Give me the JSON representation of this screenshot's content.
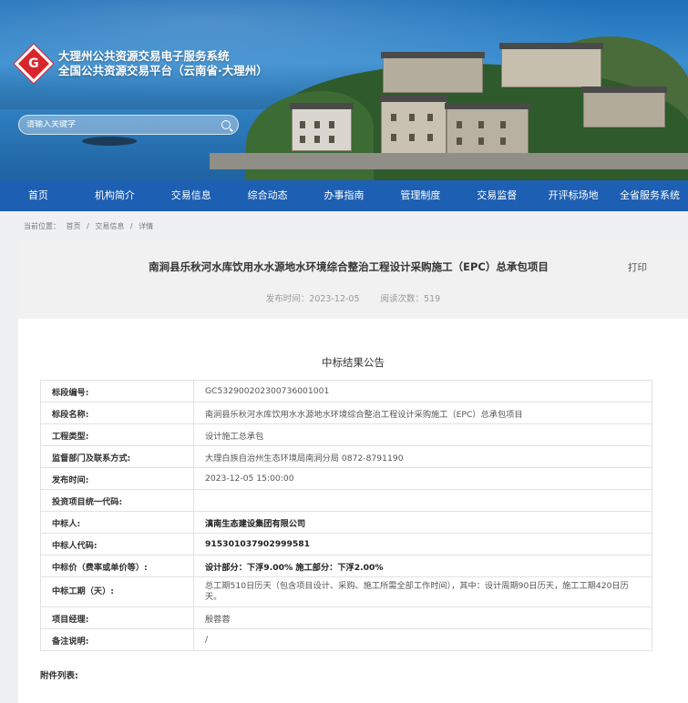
{
  "site": {
    "title_line1": "大理州公共资源交易电子服务系统",
    "title_line2": "全国公共资源交易平台（云南省·大理州）",
    "logo_glyph": "G"
  },
  "search": {
    "placeholder": "请输入关键字"
  },
  "nav": {
    "items": [
      "首页",
      "机构简介",
      "交易信息",
      "综合动态",
      "办事指南",
      "管理制度",
      "交易监督",
      "开评标场地",
      "全省服务系统"
    ]
  },
  "breadcrumb": {
    "prefix": "当前位置：",
    "items": [
      "首页",
      "交易信息",
      "详情"
    ],
    "separator": "/"
  },
  "article": {
    "title": "南涧县乐秋河水库饮用水水源地水环境综合整治工程设计采购施工（EPC）总承包项目",
    "print_label": "打印",
    "publish_label": "发布时间：2023-12-05",
    "views_label": "阅读次数：519",
    "notice_title": "中标结果公告"
  },
  "table": {
    "rows": [
      {
        "key": "标段编号:",
        "value": "GC532900202300736001001"
      },
      {
        "key": "标段名称:",
        "value": "南涧县乐秋河水库饮用水水源地水环境综合整治工程设计采购施工（EPC）总承包项目"
      },
      {
        "key": "工程类型:",
        "value": "设计施工总承包"
      },
      {
        "key": "监督部门及联系方式:",
        "value": "大理白族自治州生态环境局南涧分局 0872-8791190"
      },
      {
        "key": "发布时间:",
        "value": "2023-12-05 15:00:00"
      },
      {
        "key": "投资项目统一代码:",
        "value": ""
      },
      {
        "key": "中标人:",
        "value": "滇南生态建设集团有限公司"
      },
      {
        "key": "中标人代码:",
        "value": "91530103790299958​1"
      },
      {
        "key": "中标价（费率或单价等）:",
        "value": "设计部分：下浮9.00% 施工部分：下浮2.00%"
      },
      {
        "key": "中标工期（天）:",
        "value": "总工期510日历天（包含项目设计、采购、施工所需全部工作时间），其中：设计周期90日历天，施工工期420日历天。"
      },
      {
        "key": "项目经理:",
        "value": "殷蓉蓉"
      },
      {
        "key": "备注说明:",
        "value": "/"
      }
    ]
  },
  "attachments_label": "附件列表:"
}
